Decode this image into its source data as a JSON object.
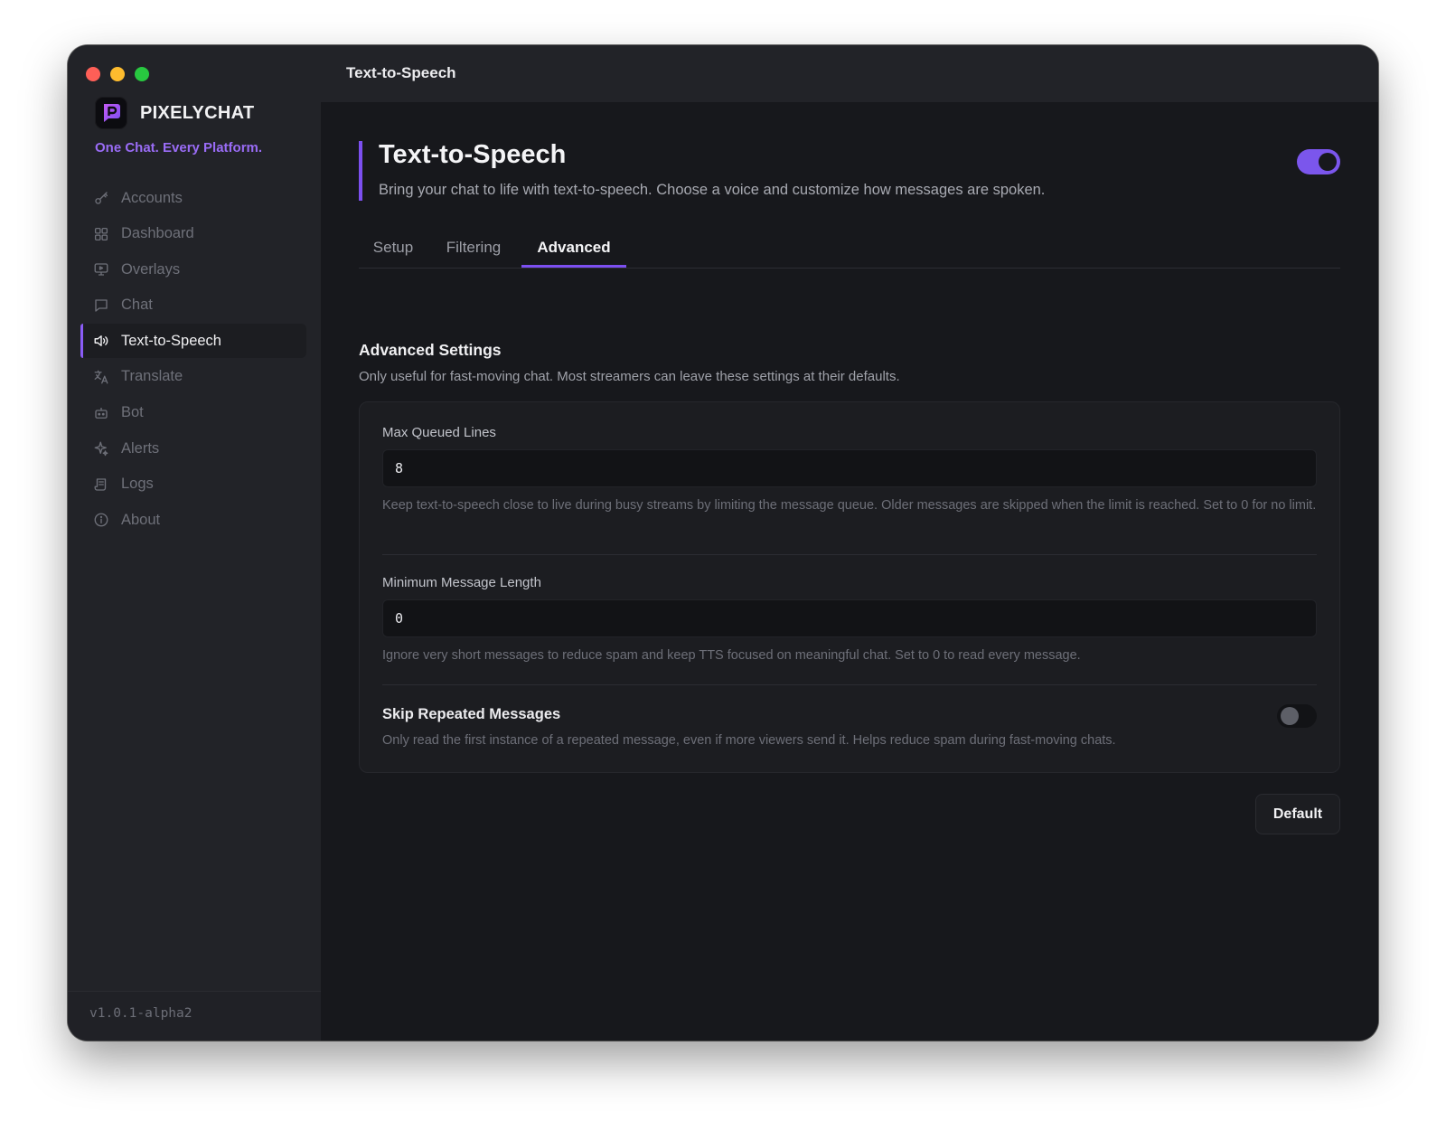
{
  "app": {
    "brand_name": "PIXELYCHAT",
    "tagline": "One Chat. Every Platform.",
    "version": "v1.0.1-alpha2",
    "window_title": "Text-to-Speech",
    "accent_color": "#7c4ff0"
  },
  "sidebar": {
    "items": [
      {
        "label": "Accounts",
        "icon": "key-icon"
      },
      {
        "label": "Dashboard",
        "icon": "grid-icon"
      },
      {
        "label": "Overlays",
        "icon": "monitor-icon"
      },
      {
        "label": "Chat",
        "icon": "chat-bubble-icon"
      },
      {
        "label": "Text-to-Speech",
        "icon": "speaker-icon",
        "active": true
      },
      {
        "label": "Translate",
        "icon": "translate-icon"
      },
      {
        "label": "Bot",
        "icon": "bot-icon"
      },
      {
        "label": "Alerts",
        "icon": "sparkle-icon"
      },
      {
        "label": "Logs",
        "icon": "scroll-icon"
      },
      {
        "label": "About",
        "icon": "info-icon"
      }
    ]
  },
  "header": {
    "title": "Text-to-Speech",
    "subtitle": "Bring your chat to life with text-to-speech. Choose a voice and customize how messages are spoken.",
    "enabled": true
  },
  "tabs": [
    {
      "label": "Setup"
    },
    {
      "label": "Filtering"
    },
    {
      "label": "Advanced",
      "active": true
    }
  ],
  "advanced": {
    "title": "Advanced Settings",
    "description": "Only useful for fast-moving chat. Most streamers can leave these settings at their defaults.",
    "max_queued": {
      "label": "Max Queued Lines",
      "value": "8",
      "help": "Keep text-to-speech close to live during busy streams by limiting the message queue. Older messages are skipped when the limit is reached. Set to 0 for no limit."
    },
    "min_length": {
      "label": "Minimum Message Length",
      "value": "0",
      "help": "Ignore very short messages to reduce spam and keep TTS focused on meaningful chat. Set to 0 to read every message."
    },
    "skip_repeated": {
      "label": "Skip Repeated Messages",
      "help": "Only read the first instance of a repeated message, even if more viewers send it. Helps reduce spam during fast-moving chats.",
      "enabled": false
    },
    "default_button": "Default"
  }
}
